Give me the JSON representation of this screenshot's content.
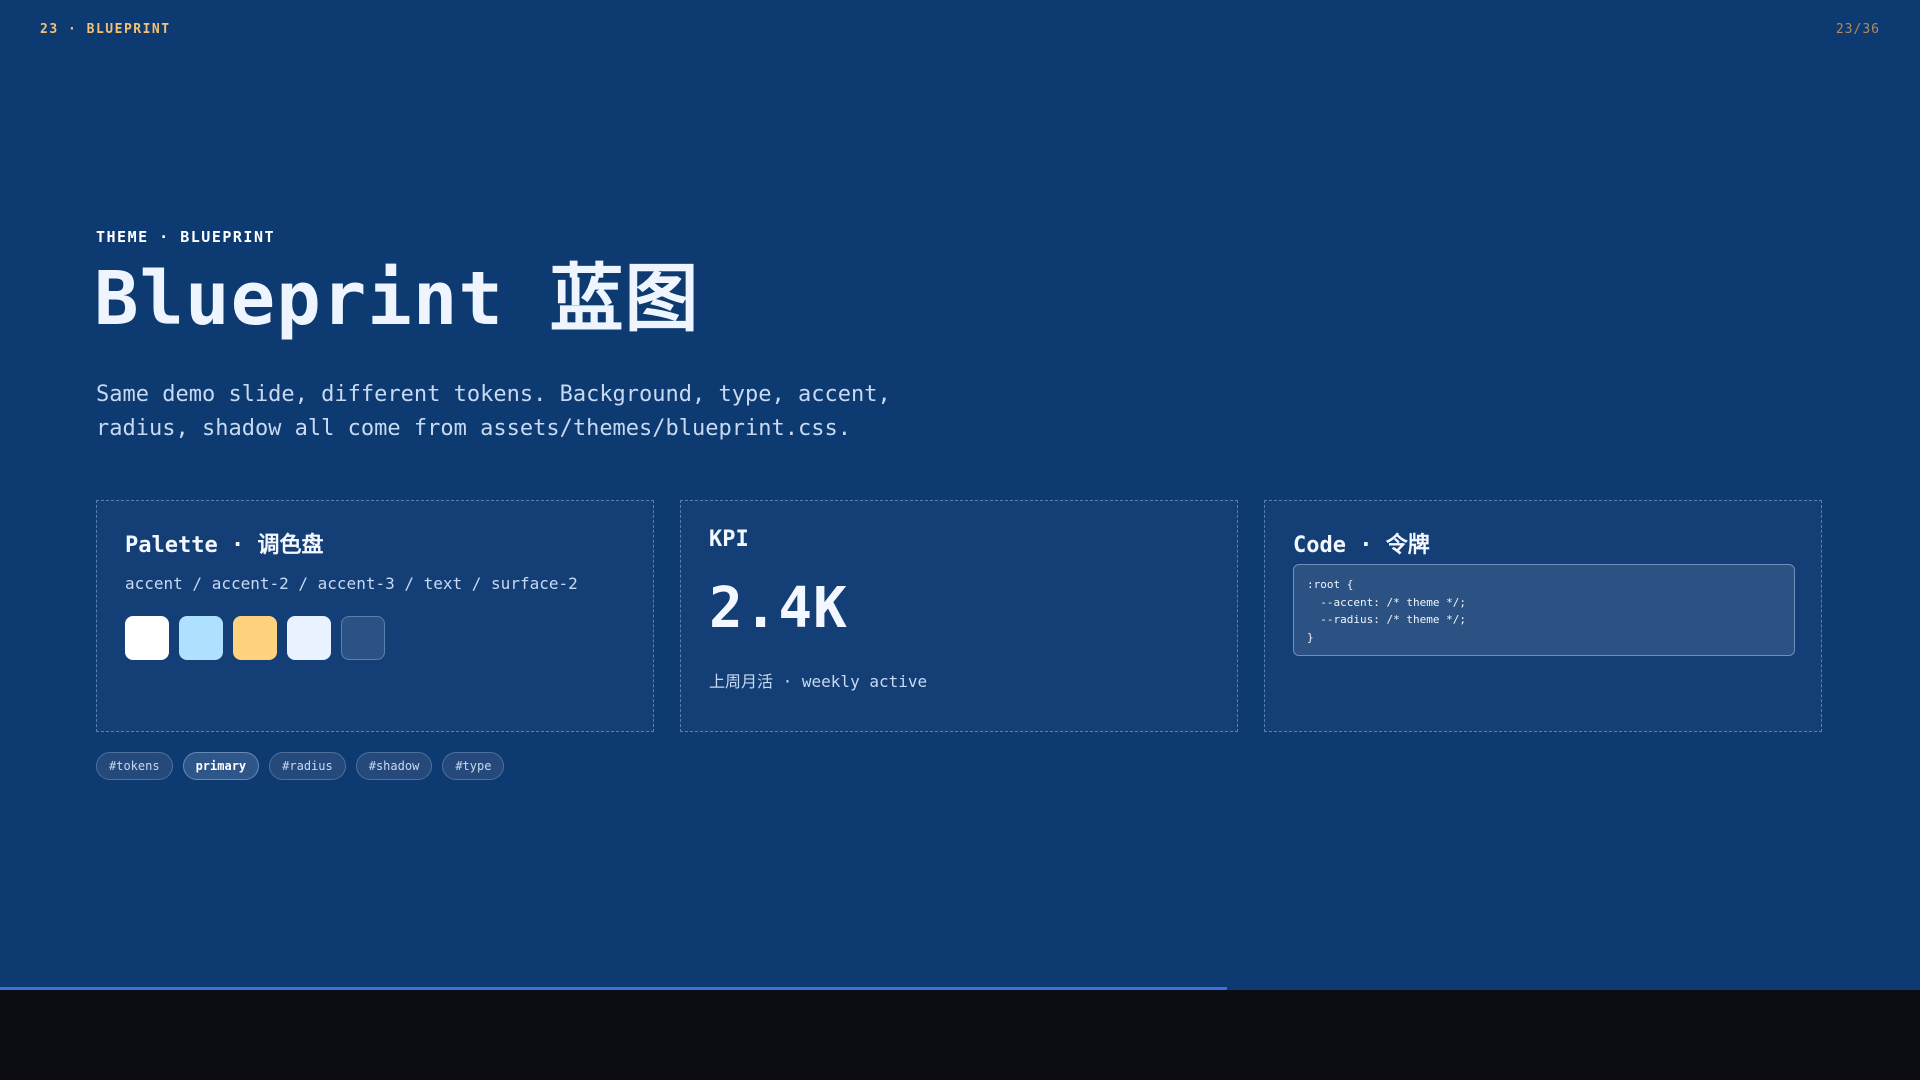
{
  "header": {
    "left": "23 · BLUEPRINT",
    "right": "23/36"
  },
  "hero": {
    "eyebrow": "THEME · BLUEPRINT",
    "title": "Blueprint 蓝图",
    "subtitle_line1": "Same demo slide, different tokens. Background, type, accent,",
    "subtitle_line2": "radius, shadow all come from assets/themes/blueprint.css."
  },
  "cards": {
    "palette": {
      "title": "Palette · 调色盘",
      "tokens": "accent / accent-2 / accent-3 / text / surface-2",
      "swatches": [
        "#ffffff",
        "#aee0ff",
        "#ffd27d",
        "#e9f2ff",
        "#2b5283"
      ]
    },
    "kpi": {
      "title": "KPI",
      "value": "2.4K",
      "caption": "上周月活 · weekly active"
    },
    "code": {
      "title": "Code · 令牌",
      "lines": [
        ":root {",
        "  --accent: /* theme */;",
        "  --radius: /* theme */;",
        "}"
      ]
    }
  },
  "tags": [
    "#tokens",
    "primary",
    "#radius",
    "#shadow",
    "#type"
  ],
  "progress": {
    "fraction": 0.639,
    "color": "#3d6fe0"
  },
  "colors": {
    "background": "#0d3a70",
    "card": "#143f76",
    "accent_orange": "#f5c275"
  }
}
